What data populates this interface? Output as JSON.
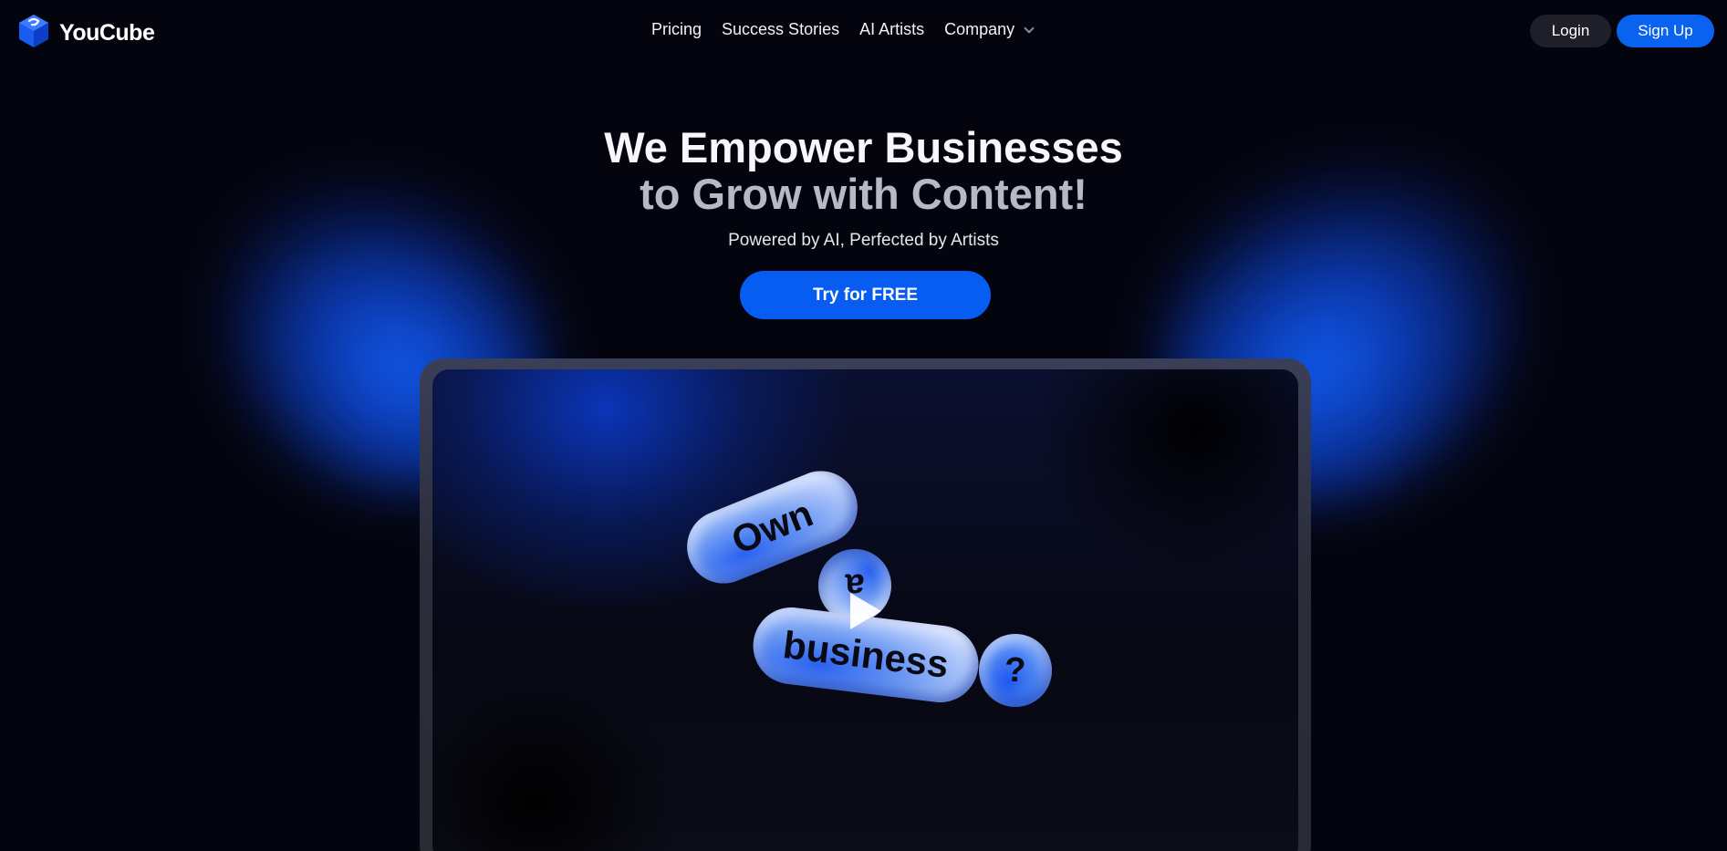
{
  "brand": {
    "name": "YouCube",
    "logo_icon": "cube-logo-icon",
    "accent": "#0a63f0"
  },
  "nav": {
    "items": [
      {
        "label": "Pricing"
      },
      {
        "label": "Success Stories"
      },
      {
        "label": "AI Artists"
      },
      {
        "label": "Company",
        "icon": "chevron-down-icon"
      }
    ]
  },
  "auth": {
    "login_label": "Login",
    "signup_label": "Sign Up"
  },
  "hero": {
    "title_line1": "We Empower Businesses",
    "title_line2": "to Grow with Content!",
    "subtitle": "Powered by AI, Perfected by Artists",
    "cta_label": "Try for FREE"
  },
  "video": {
    "words": [
      "Own",
      "a",
      "business",
      "?"
    ],
    "play_icon": "play-icon"
  }
}
